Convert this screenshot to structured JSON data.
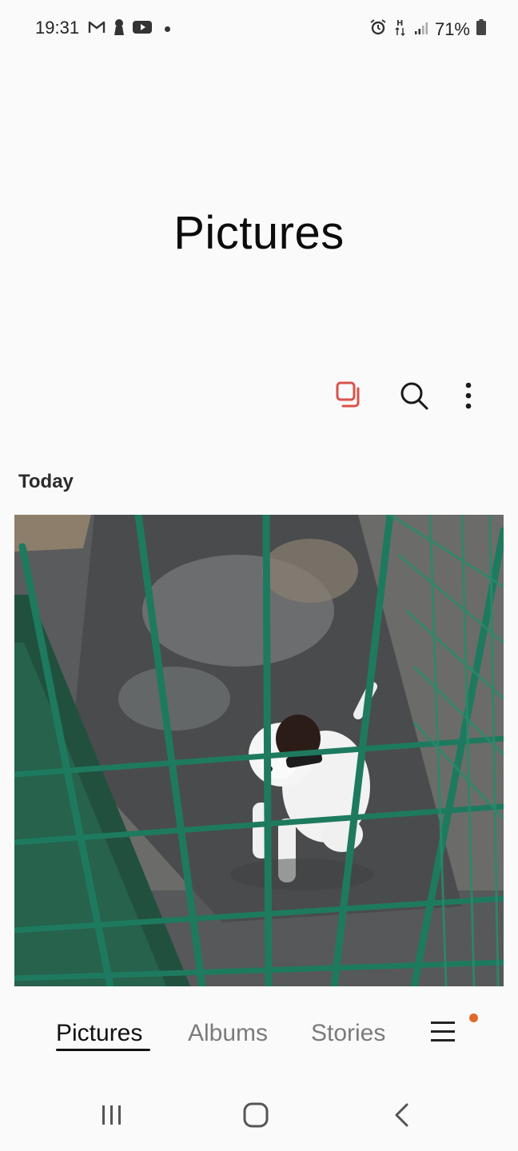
{
  "status_bar": {
    "time": "19:31",
    "battery": "71%",
    "left_icons": [
      "gmail-icon",
      "keyhole-icon",
      "youtube-icon",
      "notification-dot"
    ],
    "right_icons": [
      "alarm-icon",
      "h-data-icon",
      "signal-icon",
      "battery-icon"
    ]
  },
  "header": {
    "title": "Pictures"
  },
  "toolbar": {
    "icons": [
      "select-icon",
      "search-icon",
      "more-options-icon"
    ],
    "accent": "#d9534a"
  },
  "section": {
    "label": "Today"
  },
  "photo": {
    "subject": "dog-photo"
  },
  "bottom_tabs": {
    "items": [
      {
        "label": "Pictures",
        "active": true
      },
      {
        "label": "Albums",
        "active": false
      },
      {
        "label": "Stories",
        "active": false
      }
    ],
    "menu_icon": "hamburger-icon",
    "badge_color": "#e06a2c"
  },
  "nav_bar": {
    "icons": [
      "recent-apps-icon",
      "home-icon",
      "back-icon"
    ]
  }
}
